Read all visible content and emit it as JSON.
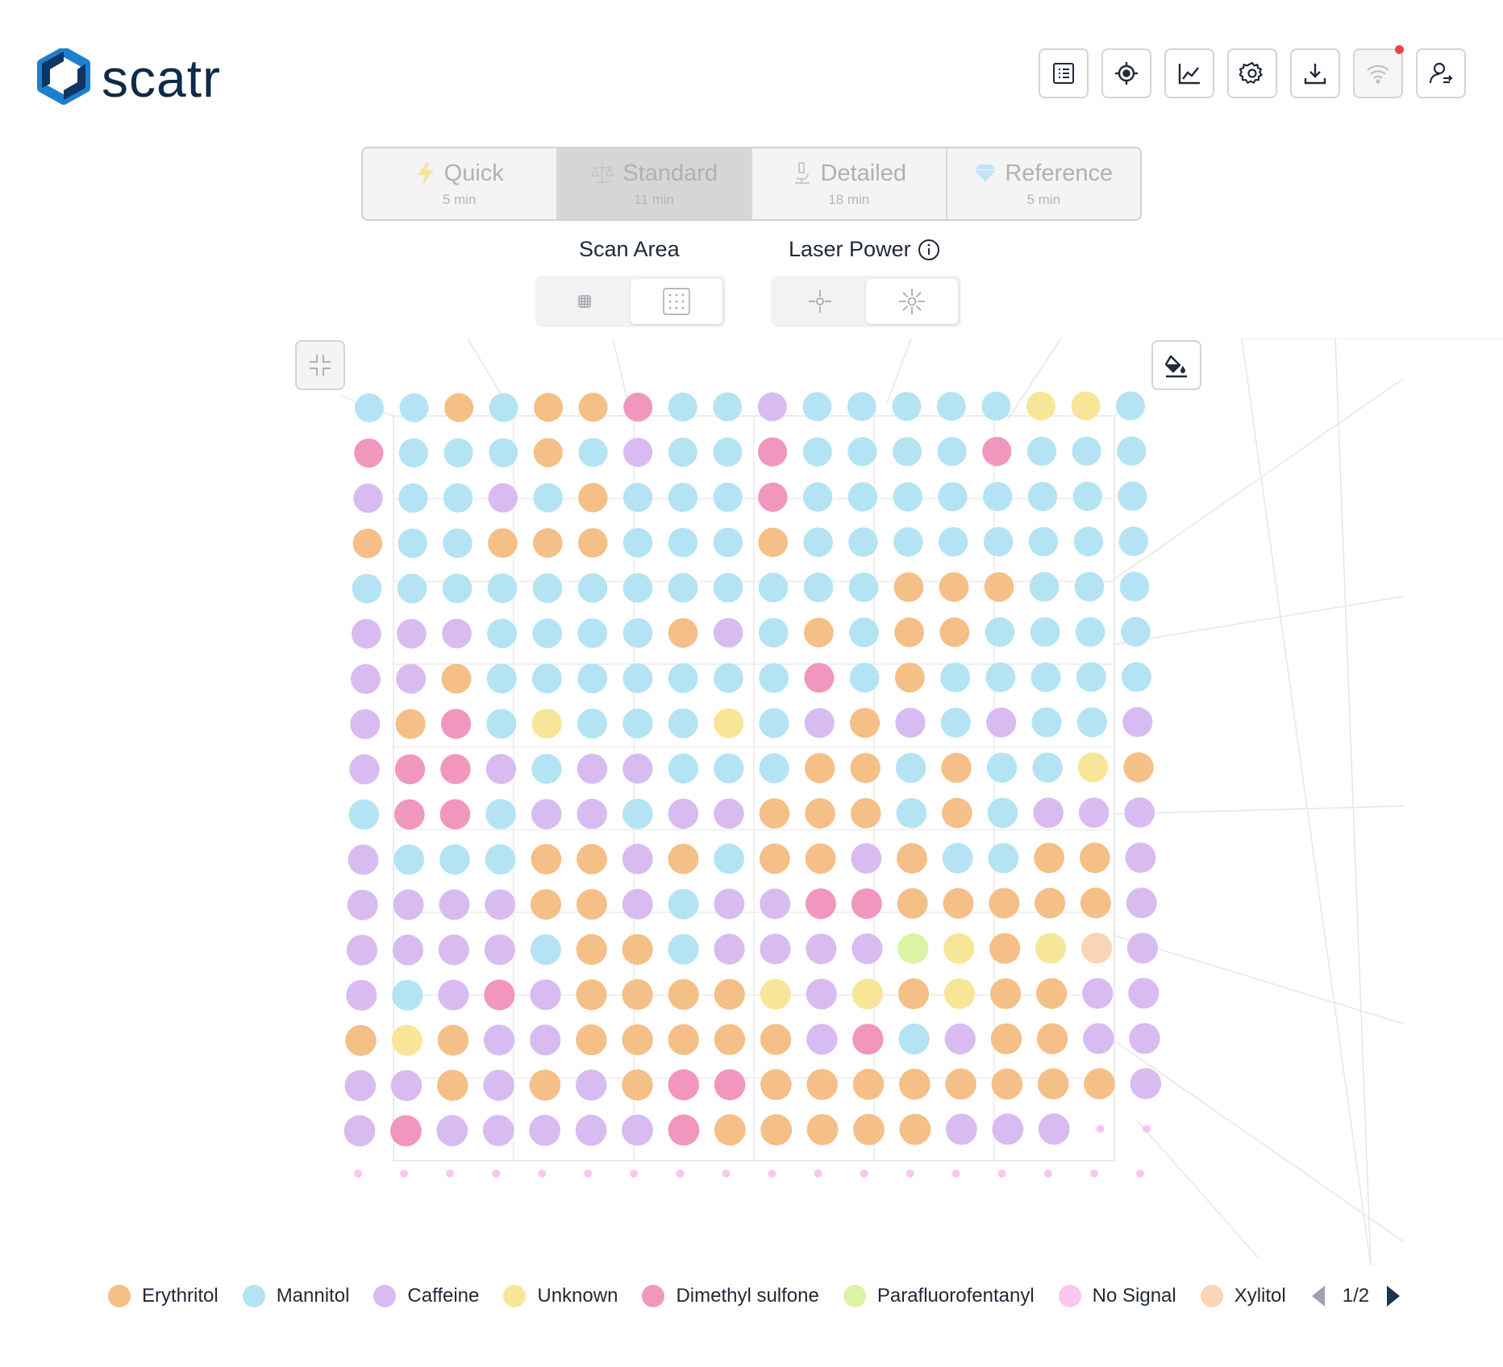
{
  "app": {
    "name": "scatr"
  },
  "toolbar": {
    "buttons": [
      {
        "icon": "list-icon"
      },
      {
        "icon": "crosshair-icon"
      },
      {
        "icon": "line-chart-icon"
      },
      {
        "icon": "gear-icon"
      },
      {
        "icon": "download-icon"
      },
      {
        "icon": "wifi-icon",
        "status_dot": "#ef4444"
      },
      {
        "icon": "user-switch-icon"
      }
    ]
  },
  "modes": [
    {
      "name": "Quick",
      "time": "5 min",
      "icon": "lightning-icon",
      "active": false
    },
    {
      "name": "Standard",
      "time": "11 min",
      "icon": "scale-icon",
      "active": true
    },
    {
      "name": "Detailed",
      "time": "18 min",
      "icon": "microscope-icon",
      "active": false
    },
    {
      "name": "Reference",
      "time": "5 min",
      "icon": "diamond-icon",
      "active": false
    }
  ],
  "scan_area": {
    "label": "Scan Area",
    "selected": "dense-grid"
  },
  "laser_power": {
    "label": "Laser Power",
    "selected": "high"
  },
  "colors": {
    "Erythritol": "#f5bf88",
    "Mannitol": "#b4e4f3",
    "Caffeine": "#d8bcf1",
    "Unknown": "#f8e698",
    "Dimethyl sulfone": "#f197be",
    "Parafluorofentanyl": "#dcf3a6",
    "No Signal": "#f9c6f2",
    "Xylitol": "#f9d5b6"
  },
  "grid_codes": [
    "E",
    "M",
    "C",
    "U",
    "D",
    "P",
    "N",
    "X"
  ],
  "grid": [
    "MMEMEEDMMCMMMMMUUM",
    "DMMMEMCMMDMMMMDMMM",
    "CMMCMEMMMDMMMMMMMM",
    "EMMEEEMMMEMMMMMMMM",
    "MMMMMMMMMMMMEEEMMM",
    "CCCMMMMECMEMEEMMMM",
    "CCEMMMMMMMDMEMMMMM",
    "CEDMUMMMUMCECMCMMC",
    "CDDCMCCMMMEEMEMMUE",
    "MDDMCCMCCEEEMEMCCC",
    "CMMMEECEMEECEMMEEC",
    "CCCCEECMCCDDEEEEEC",
    "CCCCMEEMCCCCPUEUXC",
    "CMCDCEEEEUCUEUEECC",
    "EUECCEEEEECDMCEECC",
    "CCECECEDDEEEEEEEEC",
    "CDCCCCCDEEEEECCCNN"
  ],
  "legend": {
    "items": [
      {
        "name": "Erythritol"
      },
      {
        "name": "Mannitol"
      },
      {
        "name": "Caffeine"
      },
      {
        "name": "Unknown"
      },
      {
        "name": "Dimethyl sulfone"
      },
      {
        "name": "Parafluorofentanyl"
      },
      {
        "name": "No Signal"
      },
      {
        "name": "Xylitol"
      }
    ],
    "page": "1/2"
  }
}
